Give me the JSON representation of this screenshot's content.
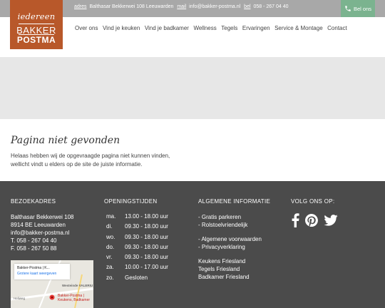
{
  "topbar": {
    "adres_label": "adres",
    "adres_value": "Balthasar Bekkerwei 108 Leeuwarden",
    "mail_label": "mail",
    "mail_value": "info@bakker-postma.nl",
    "bel_label": "bel",
    "bel_value": "058 - 267 04 40",
    "call_button": "Bel ons"
  },
  "logo": {
    "line1": "iedereen",
    "line2": "BAKKER",
    "line3": "POSTMA"
  },
  "nav": [
    "Over ons",
    "Vind je keuken",
    "Vind je badkamer",
    "Wellness",
    "Tegels",
    "Ervaringen",
    "Service & Montage",
    "Contact"
  ],
  "content": {
    "title": "Pagina niet gevonden",
    "message": "Helaas hebben wij de opgevraagde pagina niet kunnen vinden, wellicht vindt u elders op de site de juiste informatie."
  },
  "footer": {
    "address_title": "BEZOEKADRES",
    "address_lines": [
      "Balthasar Bekkerwei 108",
      "8914 BE Leeuwarden",
      "info@bakker-postma.nl",
      "T. 058 - 267 04 40",
      "F. 058 - 267 50 88"
    ],
    "hours_title": "OPENINGSTIJDEN",
    "hours": [
      {
        "day": "ma.",
        "time": "13.00 - 18.00 uur"
      },
      {
        "day": "di.",
        "time": "09.30 - 18.00 uur"
      },
      {
        "day": "wo.",
        "time": "09.30 - 18.00 uur"
      },
      {
        "day": "do.",
        "time": "09.30 - 18.00 uur"
      },
      {
        "day": "vr.",
        "time": "09.30 - 18.00 uur"
      },
      {
        "day": "za.",
        "time": "10.00 - 17.00 uur"
      },
      {
        "day": "zo.",
        "time": "Gesloten"
      }
    ],
    "info_title": "ALGEMENE INFORMATIE",
    "info_group1": [
      "- Gratis parkeren",
      "- Rolstoelvriendelijk"
    ],
    "info_group2": [
      "- Algemene voorwaarden",
      "- Privacyverklaring"
    ],
    "info_group3": [
      "Keukens Friesland",
      "Tegels Friesland",
      "Badkamer Friesland"
    ],
    "social_title": "VOLG ONS OP:",
    "social_icons": [
      "facebook-icon",
      "pinterest-icon",
      "twitter-icon"
    ],
    "map": {
      "card_title": "Bakker-Postma | K...",
      "card_link": "Grotere kaart weergeven",
      "street1": "Westeinde",
      "street2": "VALERIU",
      "street3": "Heliweg",
      "pin_label_1": "Bakker-Postma |",
      "pin_label_2": "Keukens, Badkamer"
    }
  },
  "colors": {
    "brand": "#b8582a",
    "topbar": "#a8a8a8",
    "call_button": "#7bb38f",
    "footer": "#4b4b4b",
    "banner": "#e7e7e7"
  }
}
